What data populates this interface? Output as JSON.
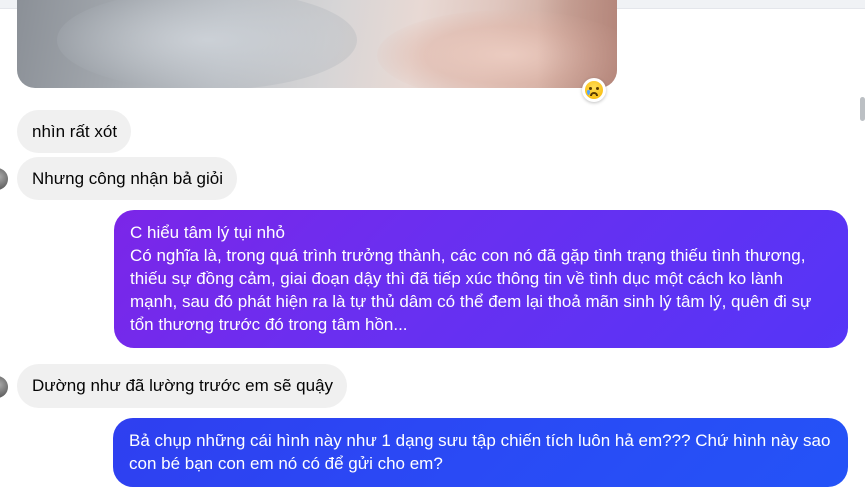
{
  "thread": {
    "photo_reaction": "sad-crying-face",
    "messages": [
      {
        "sender": "other",
        "text": "nhìn rất xót"
      },
      {
        "sender": "other",
        "text": "Nhưng công nhận bả giỏi"
      },
      {
        "sender": "self",
        "line1": "C hiểu tâm lý tụi nhỏ",
        "body": "Có nghĩa là, trong quá trình trưởng thành, các con nó đã gặp tình trạng thiếu tình thương, thiếu sự đồng cảm, giai đoạn dậy thì đã tiếp xúc thông tin về tình dục một cách ko lành mạnh, sau đó phát hiện ra là tự thủ dâm có thể đem lại thoả mãn sinh lý tâm lý, quên đi sự tổn thương trước đó trong tâm hồn..."
      },
      {
        "sender": "other",
        "text": "Dường như đã lường trước em sẽ quậy"
      },
      {
        "sender": "self",
        "text": "Bả chụp những cái hình này như 1 dạng sưu tập chiến tích luôn hả em??? Chứ hình này sao con bé bạn con em nó có để gửi cho em?"
      }
    ]
  },
  "colors": {
    "incoming_bubble": "#f0f0f0",
    "outgoing_purple": "#6a2ff0",
    "outgoing_blue": "#2a4af5"
  }
}
